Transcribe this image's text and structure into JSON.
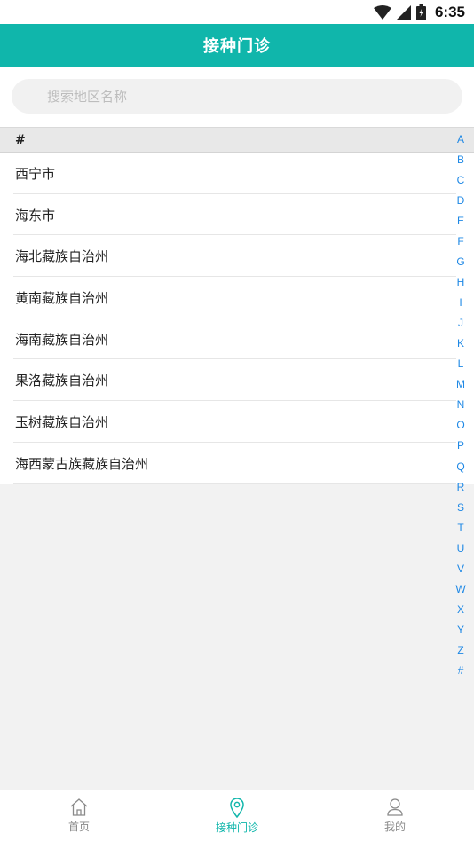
{
  "status_bar": {
    "time": "6:35"
  },
  "header": {
    "title": "接种门诊"
  },
  "search": {
    "placeholder": "搜索地区名称"
  },
  "list": {
    "section_header": "#",
    "items": [
      "西宁市",
      "海东市",
      "海北藏族自治州",
      "黄南藏族自治州",
      "海南藏族自治州",
      "果洛藏族自治州",
      "玉树藏族自治州",
      "海西蒙古族藏族自治州"
    ]
  },
  "index_bar": [
    "A",
    "B",
    "C",
    "D",
    "E",
    "F",
    "G",
    "H",
    "I",
    "J",
    "K",
    "L",
    "M",
    "N",
    "O",
    "P",
    "Q",
    "R",
    "S",
    "T",
    "U",
    "V",
    "W",
    "X",
    "Y",
    "Z",
    "#"
  ],
  "colors": {
    "accent": "#10b6ab",
    "index": "#1e88e5"
  },
  "bottom_nav": [
    {
      "label": "首页",
      "icon": "home-icon",
      "active": false
    },
    {
      "label": "接种门诊",
      "icon": "location-pin-icon",
      "active": true
    },
    {
      "label": "我的",
      "icon": "user-icon",
      "active": false
    }
  ]
}
